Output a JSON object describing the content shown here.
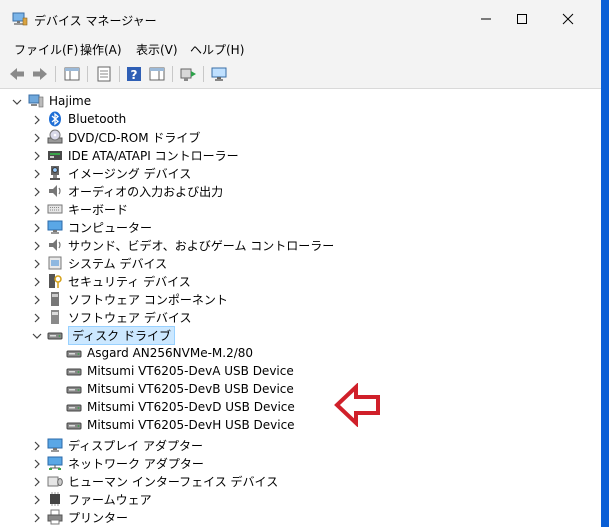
{
  "window": {
    "title": "デバイス マネージャー"
  },
  "menu": [
    "ファイル(F)",
    "操作(A)",
    "表示(V)",
    "ヘルプ(H)"
  ],
  "toolbar_icons": [
    "back-arrow-icon",
    "forward-arrow-icon",
    "show-hide-tree-icon",
    "properties-icon",
    "help-icon",
    "action-pane-icon",
    "update-driver-icon",
    "monitor-scan-icon"
  ],
  "tree": {
    "root": "Hajime",
    "categories": [
      {
        "label": "Bluetooth",
        "icon": "bluetooth-icon"
      },
      {
        "label": "DVD/CD-ROM ドライブ",
        "icon": "dvd-drive-icon"
      },
      {
        "label": "IDE ATA/ATAPI コントローラー",
        "icon": "ide-controller-icon"
      },
      {
        "label": "イメージング デバイス",
        "icon": "camera-icon"
      },
      {
        "label": "オーディオの入力および出力",
        "icon": "speaker-icon"
      },
      {
        "label": "キーボード",
        "icon": "keyboard-icon"
      },
      {
        "label": "コンピューター",
        "icon": "computer-icon"
      },
      {
        "label": "サウンド、ビデオ、およびゲーム コントローラー",
        "icon": "sound-icon"
      },
      {
        "label": "システム デバイス",
        "icon": "system-device-icon"
      },
      {
        "label": "セキュリティ デバイス",
        "icon": "security-device-icon"
      },
      {
        "label": "ソフトウェア コンポーネント",
        "icon": "software-component-icon"
      },
      {
        "label": "ソフトウェア デバイス",
        "icon": "software-device-icon"
      }
    ],
    "disk": {
      "label": "ディスク ドライブ",
      "children": [
        "Asgard AN256NVMe-M.2/80",
        "Mitsumi VT6205-DevA USB Device",
        "Mitsumi VT6205-DevB USB Device",
        "Mitsumi VT6205-DevD USB Device",
        "Mitsumi VT6205-DevH USB Device"
      ]
    },
    "after": [
      {
        "label": "ディスプレイ アダプター",
        "icon": "display-adapter-icon"
      },
      {
        "label": "ネットワーク アダプター",
        "icon": "network-adapter-icon"
      },
      {
        "label": "ヒューマン インターフェイス デバイス",
        "icon": "hid-icon"
      },
      {
        "label": "ファームウェア",
        "icon": "firmware-icon"
      },
      {
        "label": "プリンター",
        "icon": "printer-icon"
      }
    ]
  },
  "colors": {
    "selection_bg": "#cce8ff",
    "annotation_arrow": "#d0202a",
    "desktop": "#0a5fd6"
  }
}
